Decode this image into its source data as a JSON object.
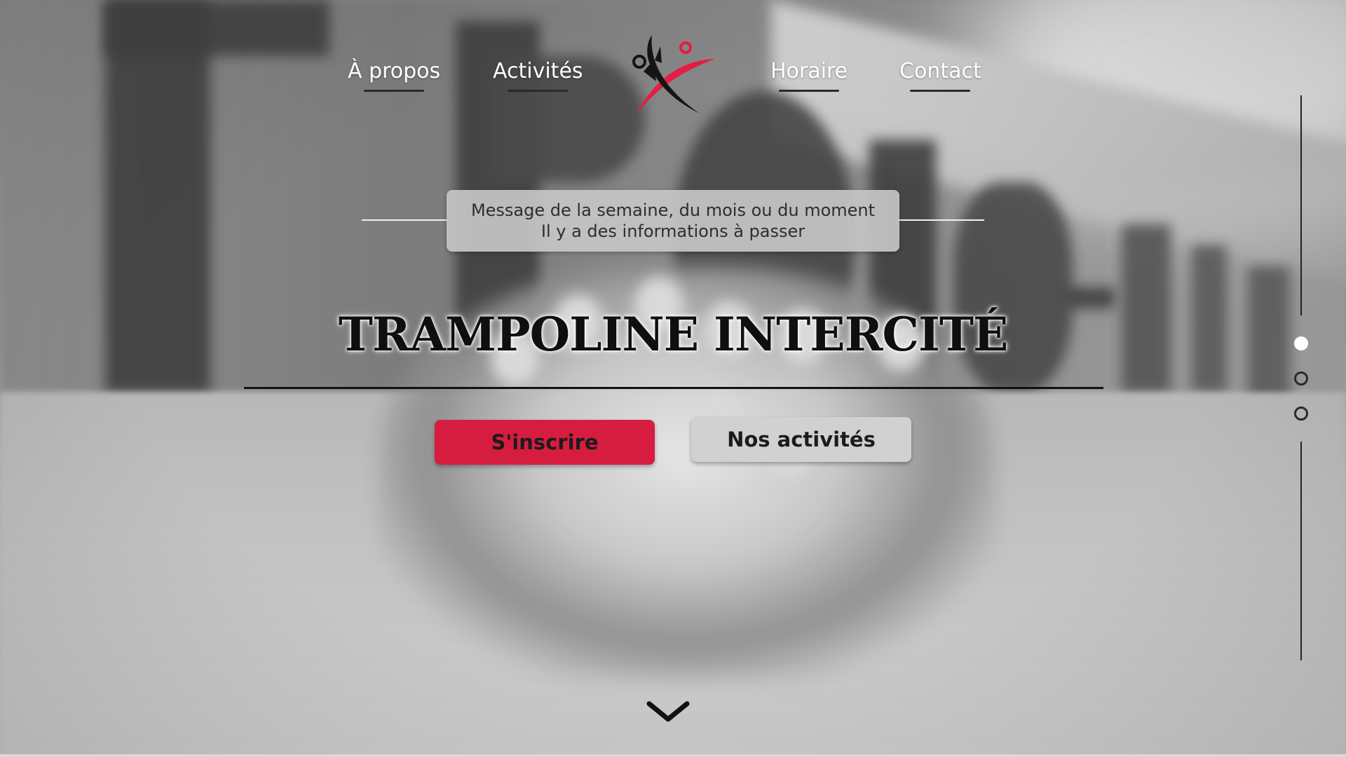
{
  "nav": {
    "items": [
      {
        "label": "À propos"
      },
      {
        "label": "Activités"
      },
      {
        "label": "Horaire"
      },
      {
        "label": "Contact"
      }
    ]
  },
  "logo": {
    "icon": "acrobat-logo-icon",
    "accent": "#e31d44"
  },
  "message": {
    "line1": "Message de la semaine, du mois ou du moment",
    "line2": "Il y a des informations à passer"
  },
  "hero": {
    "title": "TRAMPOLINE INTERCITÉ"
  },
  "buttons": {
    "signup": {
      "label": "S'inscrire",
      "color": "#d61d40"
    },
    "activities": {
      "label": "Nos activités",
      "color": "#d1d1d1"
    }
  },
  "scroll": {
    "icon": "chevron-down-icon"
  },
  "side_nav": {
    "slides": 3,
    "active_index": 0
  }
}
